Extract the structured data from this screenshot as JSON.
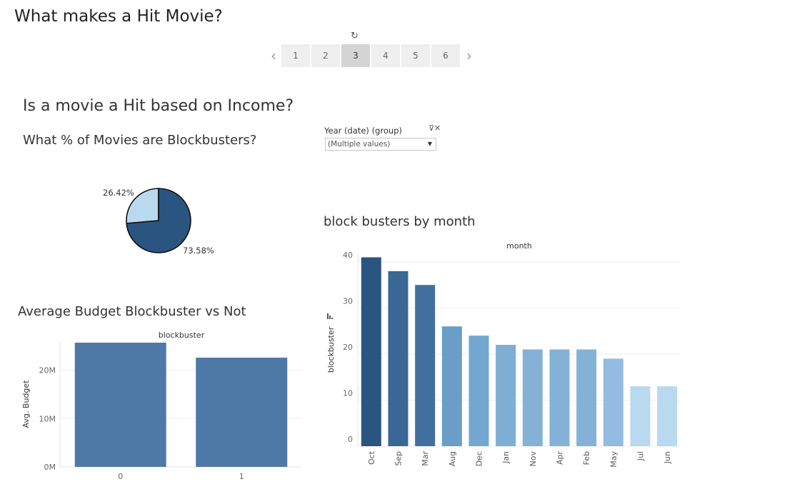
{
  "dashboard": {
    "title": "What makes a Hit Movie?",
    "reset_icon": "refresh-icon",
    "pager": {
      "prev_icon": "chevron-left-icon",
      "next_icon": "chevron-right-icon",
      "pages": [
        "1",
        "2",
        "3",
        "4",
        "5",
        "6"
      ],
      "active_page": "3"
    },
    "heading": "Is a movie a Hit based on Income?",
    "filter": {
      "label": "Year (date) (group)",
      "value": "(Multiple values)",
      "clear_icon": "filter-clear-icon",
      "dropdown_icon": "caret-down-icon"
    },
    "sort_icon": "sort-icon"
  },
  "chart_data": [
    {
      "type": "pie",
      "title": "What % of Movies are Blockbusters?",
      "slices": [
        {
          "label": "26.42%",
          "value": 26.42,
          "color": "#b9d9ef"
        },
        {
          "label": "73.58%",
          "value": 73.58,
          "color": "#2b5581"
        }
      ]
    },
    {
      "type": "bar",
      "title": "Average Budget Blockbuster vs Not",
      "top_label": "blockbuster",
      "ylabel": "Avg. Budget",
      "categories": [
        "0",
        "1"
      ],
      "values": [
        25700000,
        22600000
      ],
      "ylim": [
        0,
        26000000
      ],
      "yticks": [
        {
          "value": 0,
          "label": "0M"
        },
        {
          "value": 10000000,
          "label": "10M"
        },
        {
          "value": 20000000,
          "label": "20M"
        }
      ],
      "color": "#4e79a7",
      "grid": true
    },
    {
      "type": "bar",
      "title": "block busters by month",
      "top_label": "month",
      "ylabel": "blockbuster",
      "categories": [
        "Oct",
        "Sep",
        "Mar",
        "Aug",
        "Dec",
        "Jan",
        "Nov",
        "Apr",
        "Feb",
        "May",
        "Jul",
        "Jun"
      ],
      "values": [
        41,
        38,
        35,
        26,
        24,
        22,
        21,
        21,
        21,
        19,
        13,
        13
      ],
      "ylim": [
        0,
        42
      ],
      "yticks": [
        0,
        10,
        20,
        30,
        40
      ],
      "colors": [
        "#2b5581",
        "#3a6793",
        "#42709e",
        "#6a9ec8",
        "#74a7cf",
        "#7eaed4",
        "#84b2d7",
        "#84b2d7",
        "#84b2d7",
        "#93bce0",
        "#b9d9ef",
        "#b9d9ef"
      ],
      "grid": true
    }
  ]
}
